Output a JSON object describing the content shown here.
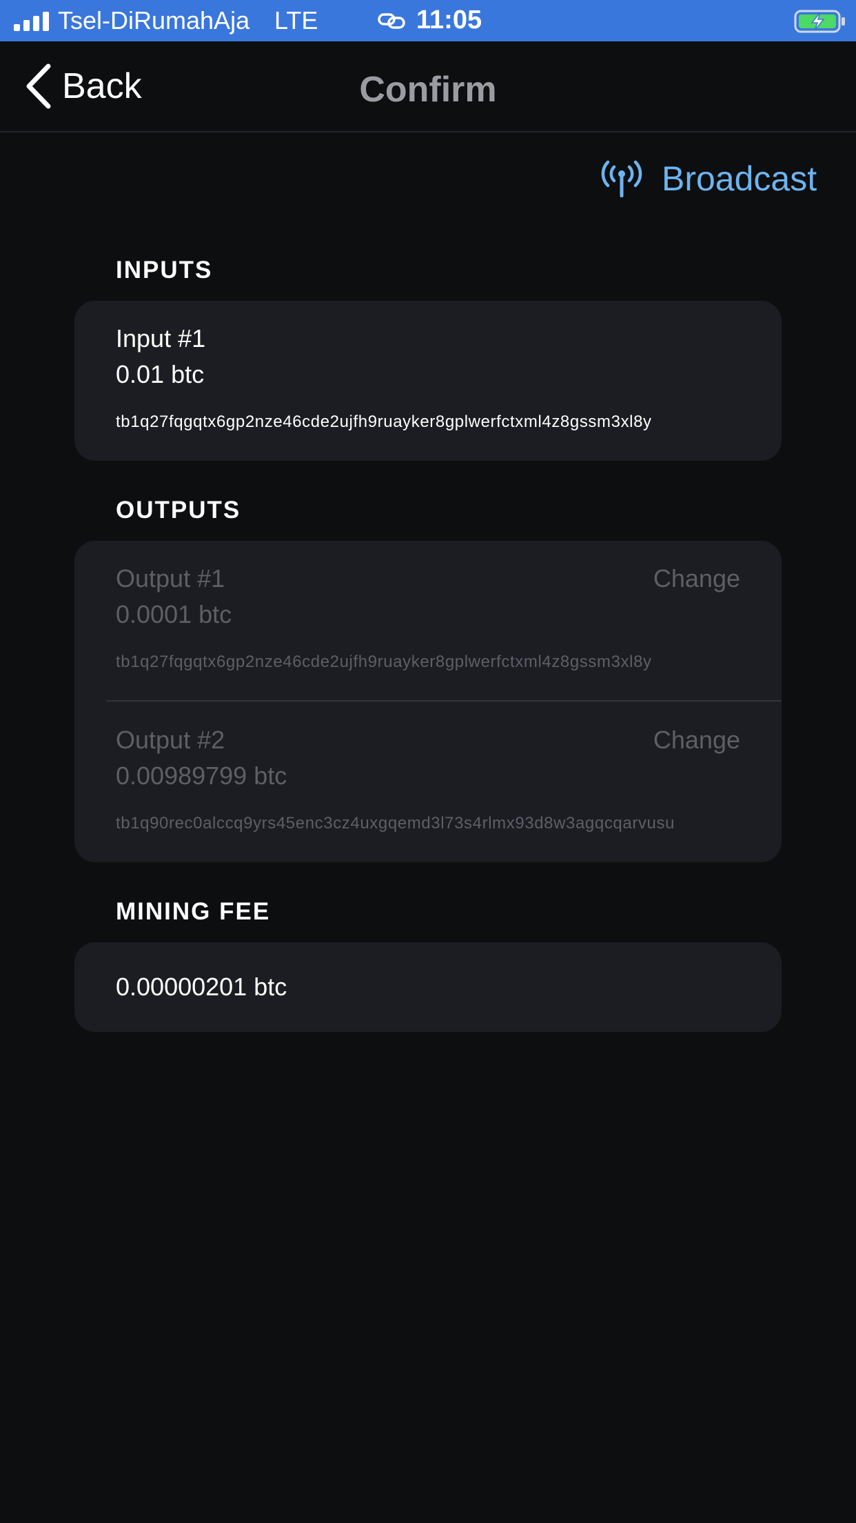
{
  "status_bar": {
    "carrier": "Tsel-DiRumahAja",
    "network": "LTE",
    "time": "11:05",
    "signal_icon": "signal-bars-icon",
    "link_icon": "link-icon",
    "battery_icon": "battery-charging-icon",
    "background_color": "#3a77dc"
  },
  "nav": {
    "back_label": "Back",
    "title": "Confirm"
  },
  "broadcast": {
    "label": "Broadcast",
    "icon": "antenna-icon",
    "color": "#6db4f0"
  },
  "inputs": {
    "title": "INPUTS",
    "items": [
      {
        "title": "Input #1",
        "amount": "0.01 btc",
        "address": "tb1q27fqgqtx6gp2nze46cde2ujfh9ruayker8gplwerfctxml4z8gssm3xl8y"
      }
    ]
  },
  "outputs": {
    "title": "OUTPUTS",
    "items": [
      {
        "title": "Output #1",
        "tag": "Change",
        "amount": "0.0001 btc",
        "address": "tb1q27fqgqtx6gp2nze46cde2ujfh9ruayker8gplwerfctxml4z8gssm3xl8y"
      },
      {
        "title": "Output #2",
        "tag": "Change",
        "amount": "0.00989799 btc",
        "address": "tb1q90rec0alccq9yrs45enc3cz4uxgqemd3l73s4rlmx93d8w3agqcqarvusu"
      }
    ]
  },
  "mining_fee": {
    "title": "MINING FEE",
    "amount": "0.00000201 btc"
  }
}
